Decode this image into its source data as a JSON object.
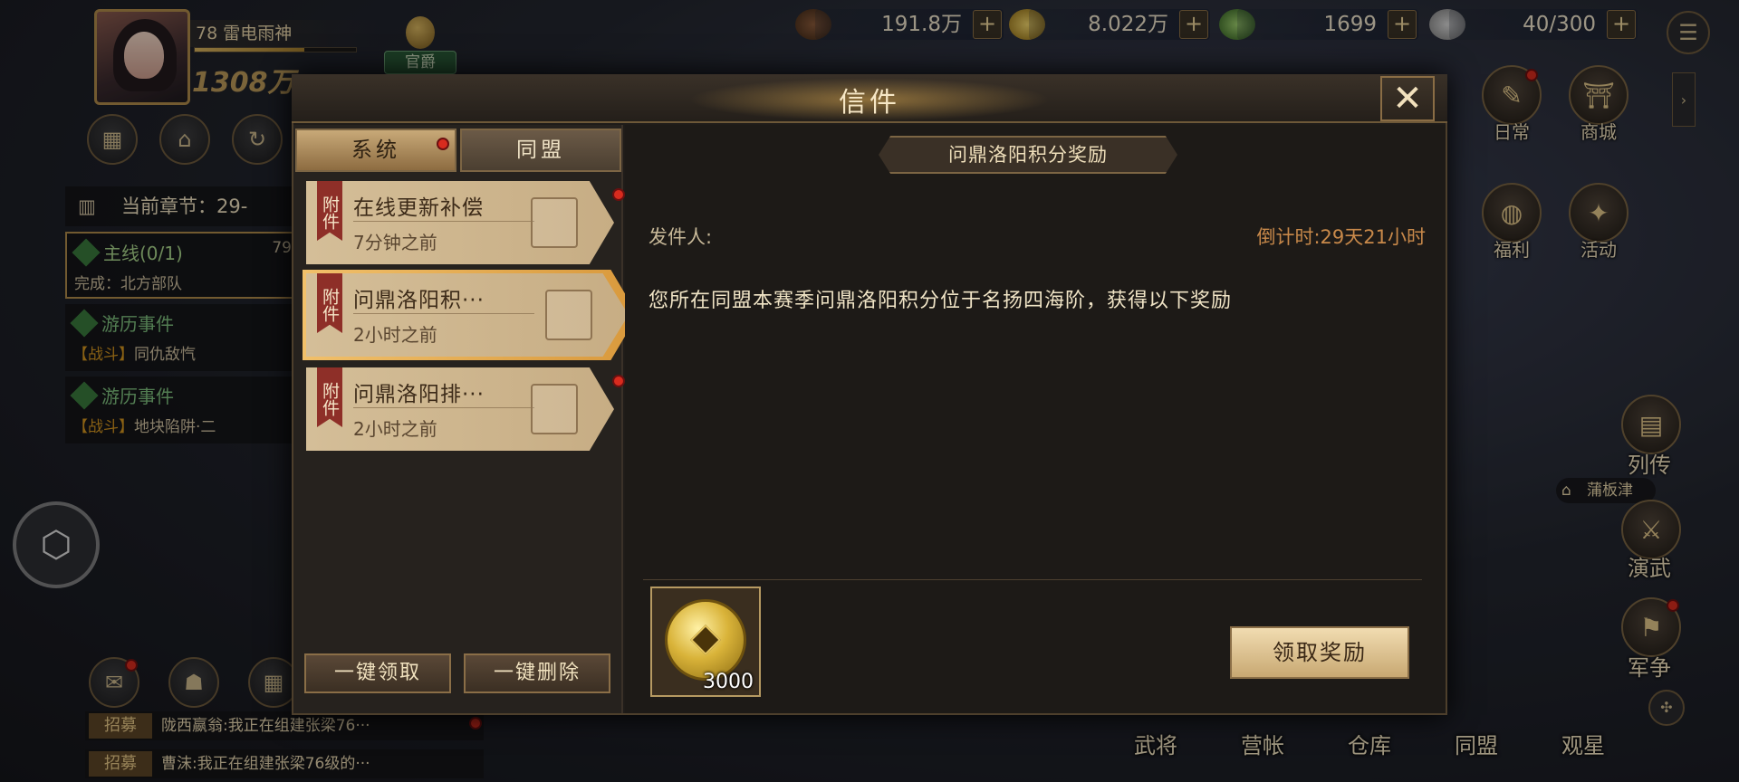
{
  "player": {
    "vip_level_name": "78 雷电雨神",
    "power": "1308万",
    "rank_badge": "官爵",
    "exp_fraction": 0.68
  },
  "resources": [
    {
      "icon": "coins-stack-icon",
      "value": "191.8万"
    },
    {
      "icon": "gold-coin-icon",
      "value": "8.022万"
    },
    {
      "icon": "jade-icon",
      "value": "1699"
    },
    {
      "icon": "stamina-icon",
      "value": "40/300"
    }
  ],
  "right_icons": [
    {
      "icon": "scroll-icon",
      "label": "日常"
    },
    {
      "icon": "shop-icon",
      "label": "商城"
    },
    {
      "icon": "bag-icon",
      "label": "福利"
    },
    {
      "icon": "event-icon",
      "label": "活动"
    }
  ],
  "right_side": {
    "biography": "列传",
    "drill": "演武",
    "war": "军争",
    "place": "蒲板津"
  },
  "bottom_nav": [
    "武将",
    "营帐",
    "仓库",
    "同盟",
    "观星"
  ],
  "quest_panel": {
    "chapter_label": "当前章节：29-",
    "items": [
      {
        "title": "主线(0/1)",
        "side_note": "79",
        "desc": "完成：北方部队"
      },
      {
        "title": "游历事件",
        "desc_tag": "战斗",
        "desc": "同仇敌忾"
      },
      {
        "title": "游历事件",
        "desc_tag": "战斗",
        "desc": "地块陷阱·二"
      }
    ]
  },
  "chat": [
    {
      "tag": "招募",
      "text": "陇西嬴翁:我正在组建张梁76···"
    },
    {
      "tag": "招募",
      "text": "曹沫:我正在组建张梁76级的···"
    }
  ],
  "mail_dialog": {
    "title": "信件",
    "tabs": [
      {
        "label": "系统",
        "active": true
      },
      {
        "label": "同盟",
        "active": false
      }
    ],
    "mails": [
      {
        "tag": "附件",
        "title": "在线更新补偿",
        "time": "7分钟之前",
        "selected": false
      },
      {
        "tag": "附件",
        "title": "问鼎洛阳积···",
        "time": "2小时之前",
        "selected": true
      },
      {
        "tag": "附件",
        "title": "问鼎洛阳排···",
        "time": "2小时之前",
        "selected": false
      }
    ],
    "buttons": {
      "claim_all": "一键领取",
      "delete_all": "一键删除"
    },
    "detail": {
      "subject": "问鼎洛阳积分奖励",
      "sender_label": "发件人:",
      "countdown": "倒计时:29天21小时",
      "body": "您所在同盟本赛季问鼎洛阳积分位于名扬四海阶，获得以下奖励",
      "reward": {
        "icon": "copper-coin-icon",
        "count": "3000"
      },
      "claim_button": "领取奖励"
    }
  }
}
